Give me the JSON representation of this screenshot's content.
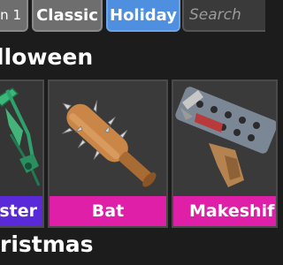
{
  "tabs": {
    "season": "on 1",
    "classic": "Classic",
    "holiday": "Holiday"
  },
  "search": {
    "placeholder": "Search"
  },
  "sections": {
    "halloween_title": "lloween",
    "christmas_title": "ristmas"
  },
  "items": [
    {
      "name": "ster",
      "label_color": "#5a2ad8",
      "icon": "scythe-icon"
    },
    {
      "name": "Bat",
      "label_color": "#e01fa8",
      "icon": "spiked-bat-icon"
    },
    {
      "name": "Makeshif",
      "label_color": "#e01fa8",
      "icon": "makeshift-gun-icon"
    }
  ],
  "colors": {
    "selected_tab": "#4f8fe0",
    "unselected_tab": "#6e6e6e",
    "card_bg": "#3a3a3a",
    "page_bg": "#1c1c1c"
  }
}
